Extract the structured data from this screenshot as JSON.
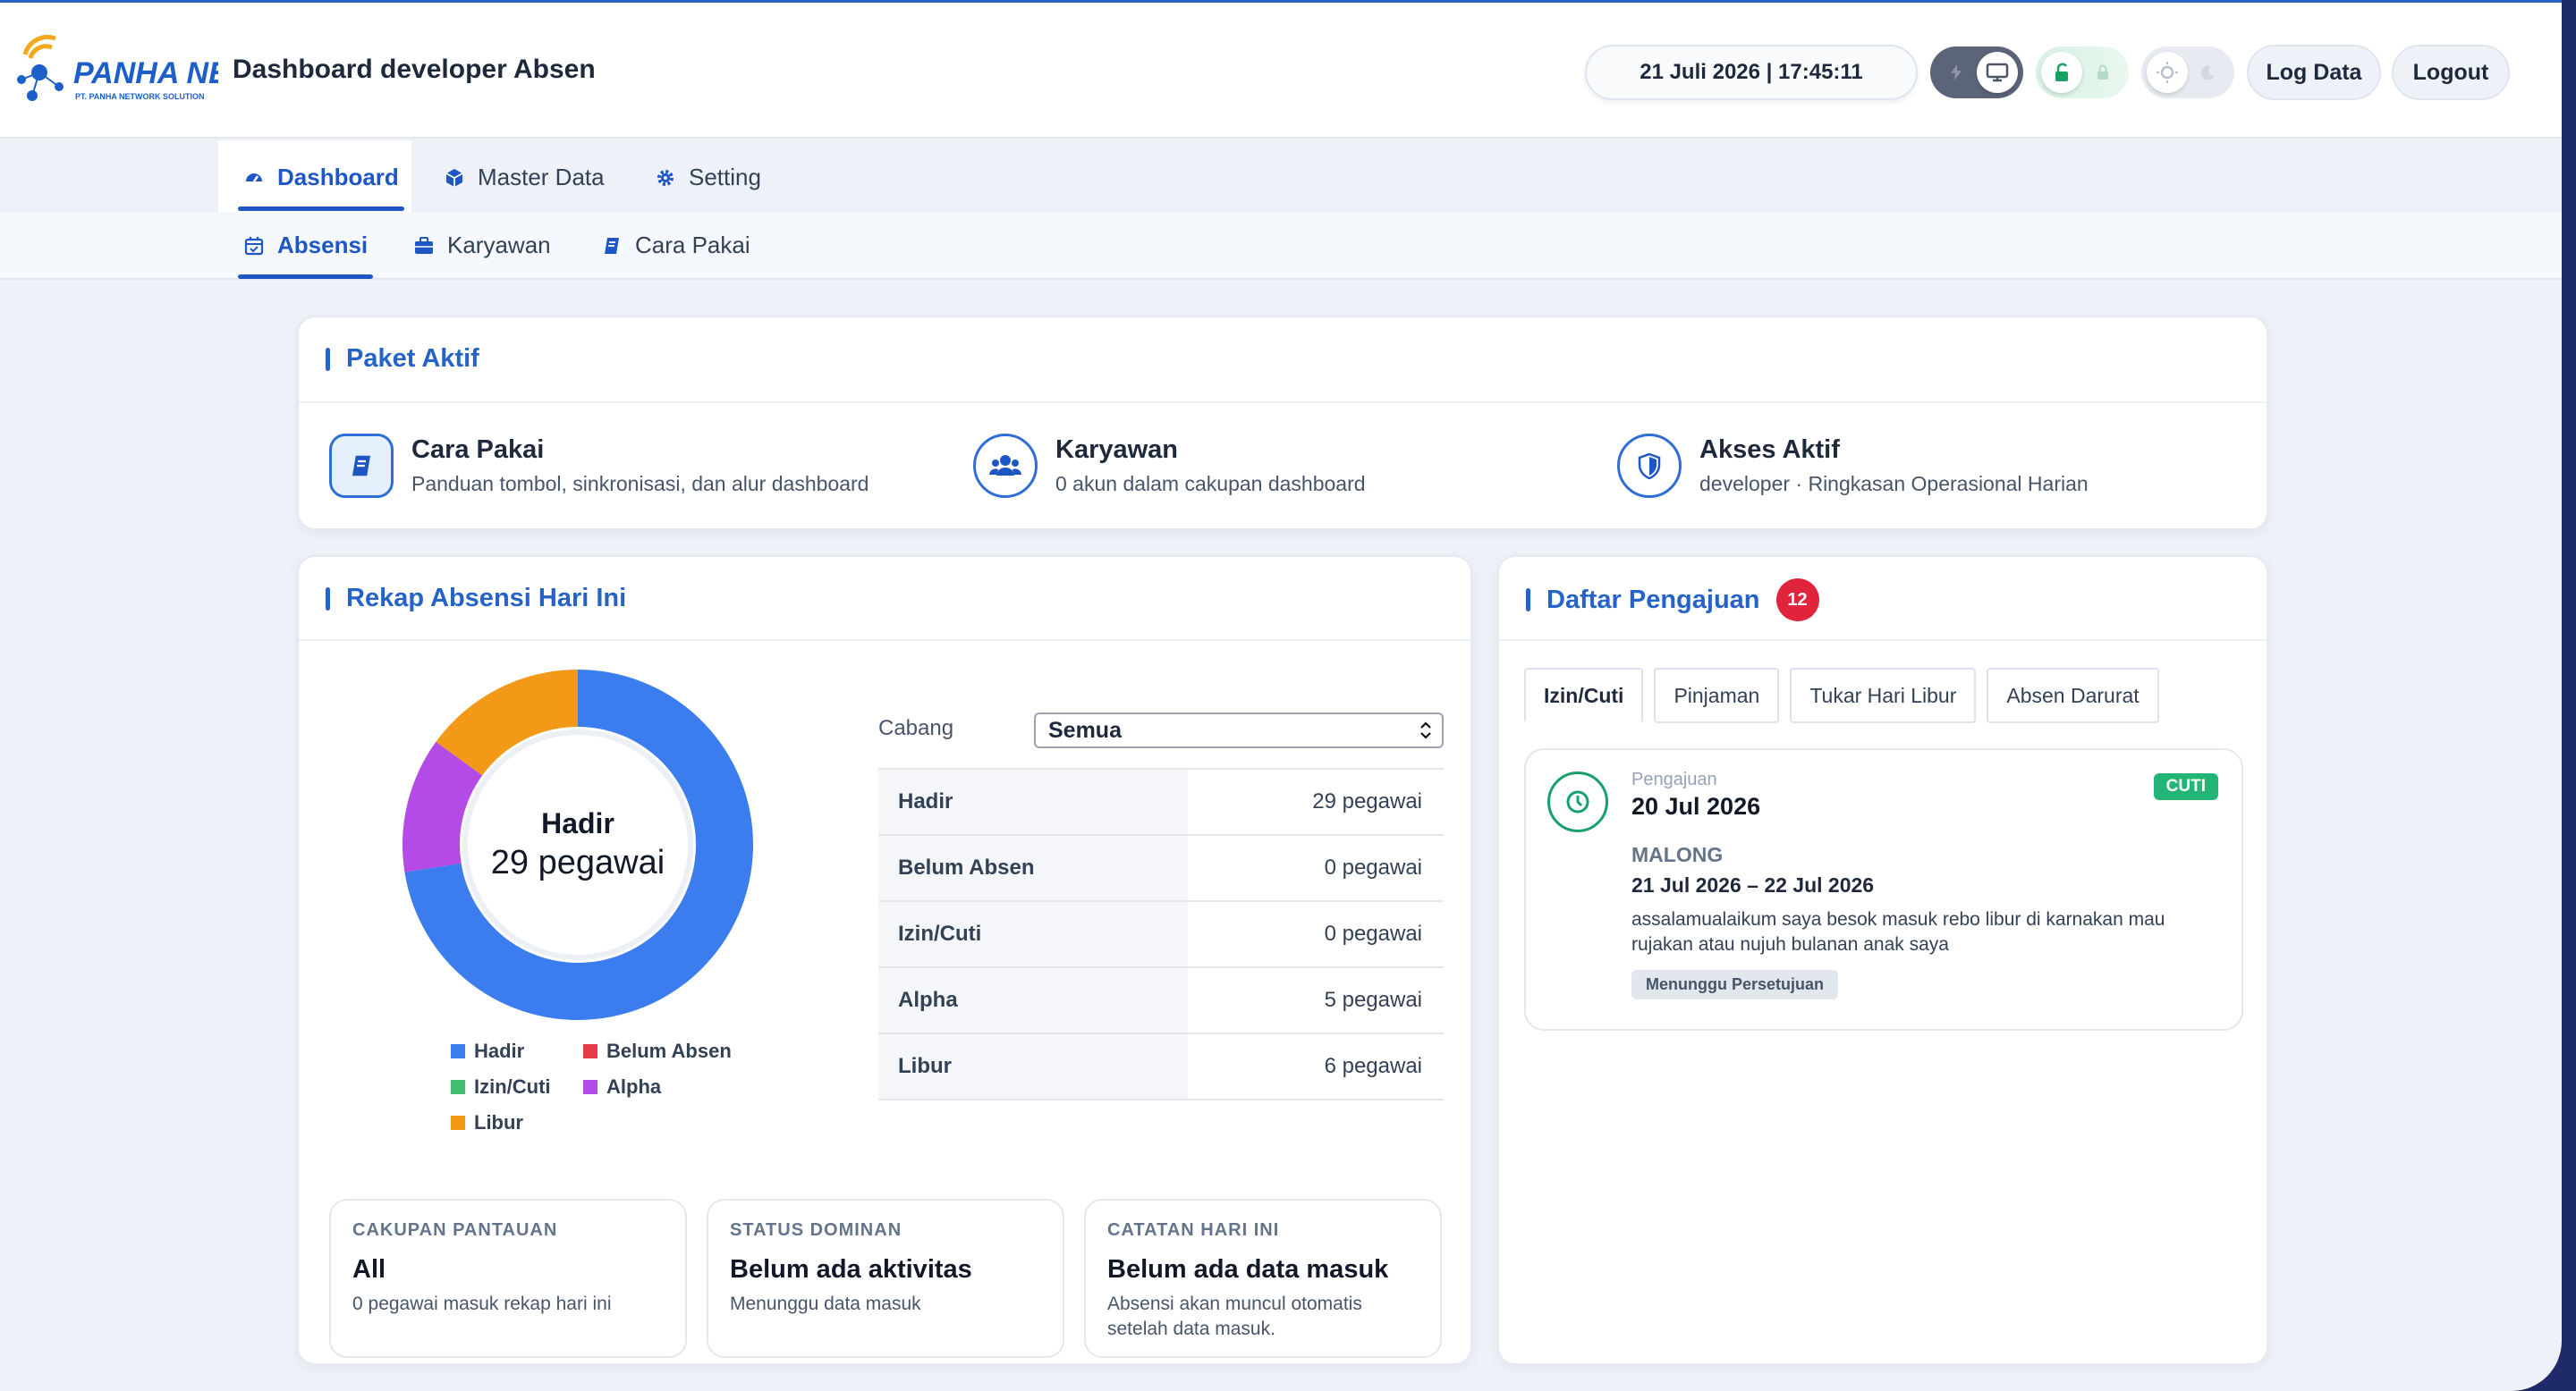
{
  "header": {
    "logo_text": "PANHA NET",
    "logo_subtext": "PT. PANHA NETWORK SOLUTION",
    "title": "Dashboard developer Absen",
    "datetime": "21 Juli 2026 | 17:45:11",
    "log_button": "Log Data",
    "logout_button": "Logout"
  },
  "nav_main": [
    {
      "label": "Dashboard",
      "icon": "gauge-icon",
      "active": true
    },
    {
      "label": "Master Data",
      "icon": "cube-icon",
      "active": false
    },
    {
      "label": "Setting",
      "icon": "gear-icon",
      "active": false
    }
  ],
  "nav_sub": [
    {
      "label": "Absensi",
      "icon": "calendar-check-icon",
      "active": true
    },
    {
      "label": "Karyawan",
      "icon": "briefcase-icon",
      "active": false
    },
    {
      "label": "Cara Pakai",
      "icon": "book-icon",
      "active": false
    }
  ],
  "paket": {
    "title": "Paket Aktif",
    "items": [
      {
        "title": "Cara Pakai",
        "subtitle": "Panduan tombol, sinkronisasi, dan alur dashboard",
        "icon": "book-icon"
      },
      {
        "title": "Karyawan",
        "subtitle": "0 akun dalam cakupan dashboard",
        "icon": "users-icon"
      },
      {
        "title": "Akses Aktif",
        "subtitle": "developer · Ringkasan Operasional Harian",
        "icon": "shield-icon"
      }
    ]
  },
  "rekap": {
    "title": "Rekap Absensi Hari Ini",
    "center_label": "Hadir",
    "center_value": "29 pegawai",
    "cabang_label": "Cabang",
    "cabang_value": "Semua",
    "rows": [
      {
        "label": "Hadir",
        "value": "29 pegawai"
      },
      {
        "label": "Belum Absen",
        "value": "0 pegawai"
      },
      {
        "label": "Izin/Cuti",
        "value": "0 pegawai"
      },
      {
        "label": "Alpha",
        "value": "5 pegawai"
      },
      {
        "label": "Libur",
        "value": "6 pegawai"
      }
    ],
    "summary": [
      {
        "caption": "CAKUPAN PANTAUAN",
        "title": "All",
        "text": "0 pegawai masuk rekap hari ini"
      },
      {
        "caption": "STATUS DOMINAN",
        "title": "Belum ada aktivitas",
        "text": "Menunggu data masuk"
      },
      {
        "caption": "CATATAN HARI INI",
        "title": "Belum ada data masuk",
        "text": "Absensi akan muncul otomatis setelah data masuk."
      }
    ]
  },
  "chart_data": {
    "type": "pie",
    "categories": [
      "Hadir",
      "Belum Absen",
      "Izin/Cuti",
      "Alpha",
      "Libur"
    ],
    "values": [
      29,
      0,
      0,
      5,
      6
    ],
    "colors": [
      "#3b7cef",
      "#e83b4a",
      "#3fbf6f",
      "#b54be6",
      "#f29a17"
    ],
    "legend": "bottom"
  },
  "pengajuan": {
    "title": "Daftar Pengajuan",
    "count": "12",
    "tabs": [
      "Izin/Cuti",
      "Pinjaman",
      "Tukar Hari Libur",
      "Absen Darurat"
    ],
    "item": {
      "label": "Pengajuan",
      "date": "20 Jul 2026",
      "type": "CUTI",
      "name": "MALONG",
      "range": "21 Jul 2026 – 22 Jul 2026",
      "note": "assalamualaikum saya besok masuk rebo libur di karnakan mau rujakan atau nujuh bulanan anak saya",
      "status": "Menunggu Persetujuan"
    }
  }
}
